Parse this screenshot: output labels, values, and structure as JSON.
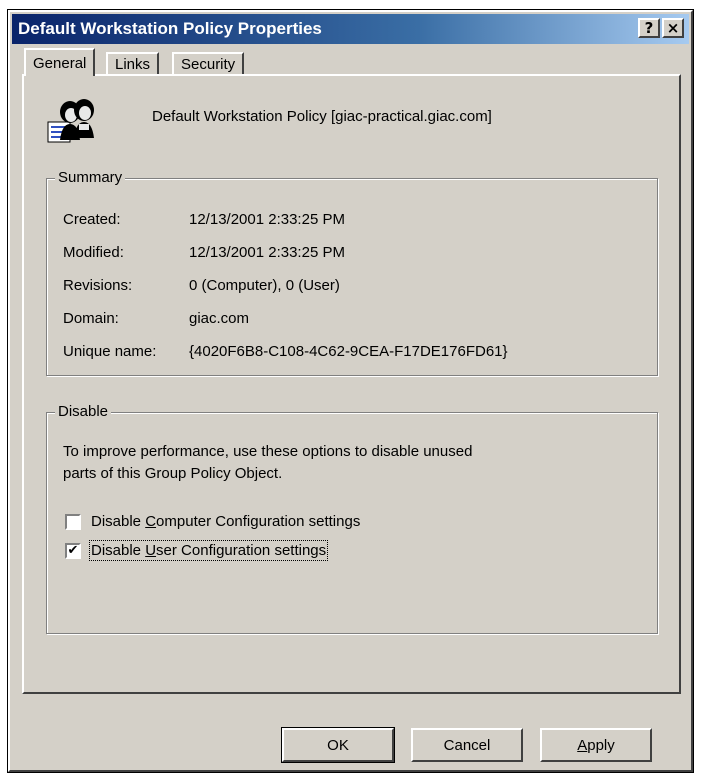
{
  "window": {
    "title": "Default Workstation Policy Properties",
    "help_label": "?",
    "close_label": "×"
  },
  "tabs": [
    {
      "label": "General",
      "active": true
    },
    {
      "label": "Links",
      "active": false
    },
    {
      "label": "Security",
      "active": false
    }
  ],
  "header": {
    "icon": "group-policy-users-icon",
    "policy_name": "Default Workstation Policy [giac-practical.giac.com]"
  },
  "summary": {
    "legend": "Summary",
    "rows": [
      {
        "label": "Created:",
        "value": "12/13/2001 2:33:25 PM"
      },
      {
        "label": "Modified:",
        "value": "12/13/2001 2:33:25 PM"
      },
      {
        "label": "Revisions:",
        "value": "0 (Computer), 0 (User)"
      },
      {
        "label": "Domain:",
        "value": "giac.com"
      },
      {
        "label": "Unique name:",
        "value": "{4020F6B8-C108-4C62-9CEA-F17DE176FD61}"
      }
    ]
  },
  "disable": {
    "legend": "Disable",
    "description_line1": "To improve performance, use these options to disable unused",
    "description_line2": "parts of this Group Policy Object.",
    "computer": {
      "pre": "Disable ",
      "accel": "C",
      "post": "omputer Configuration settings",
      "checked": false
    },
    "user": {
      "pre": "Disable ",
      "accel": "U",
      "post": "ser Configuration settings",
      "checked": true
    }
  },
  "buttons": {
    "ok": "OK",
    "cancel": "Cancel",
    "apply_accel": "A",
    "apply_rest": "pply"
  }
}
